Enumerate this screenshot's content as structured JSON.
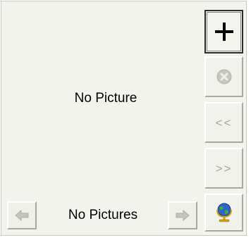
{
  "viewer": {
    "empty_message": "No Picture",
    "count_label": "No Pictures"
  },
  "side_toolbar": {
    "add": {
      "icon": "plus-icon",
      "label": "+"
    },
    "remove": {
      "icon": "delete-circle-icon",
      "enabled": false
    },
    "move_left": {
      "label": "<<",
      "enabled": false
    },
    "move_right": {
      "label": ">>",
      "enabled": false
    },
    "web": {
      "icon": "globe-icon"
    }
  },
  "nav": {
    "prev": {
      "icon": "left-arrow-icon",
      "enabled": false
    },
    "next": {
      "icon": "right-arrow-icon",
      "enabled": false
    }
  },
  "colors": {
    "panel_bg": "#f3f3ee",
    "disabled_glyph": "#a6a6a0",
    "globe_blue": "#2f64c6",
    "stand_gold": "#d1a10f"
  }
}
